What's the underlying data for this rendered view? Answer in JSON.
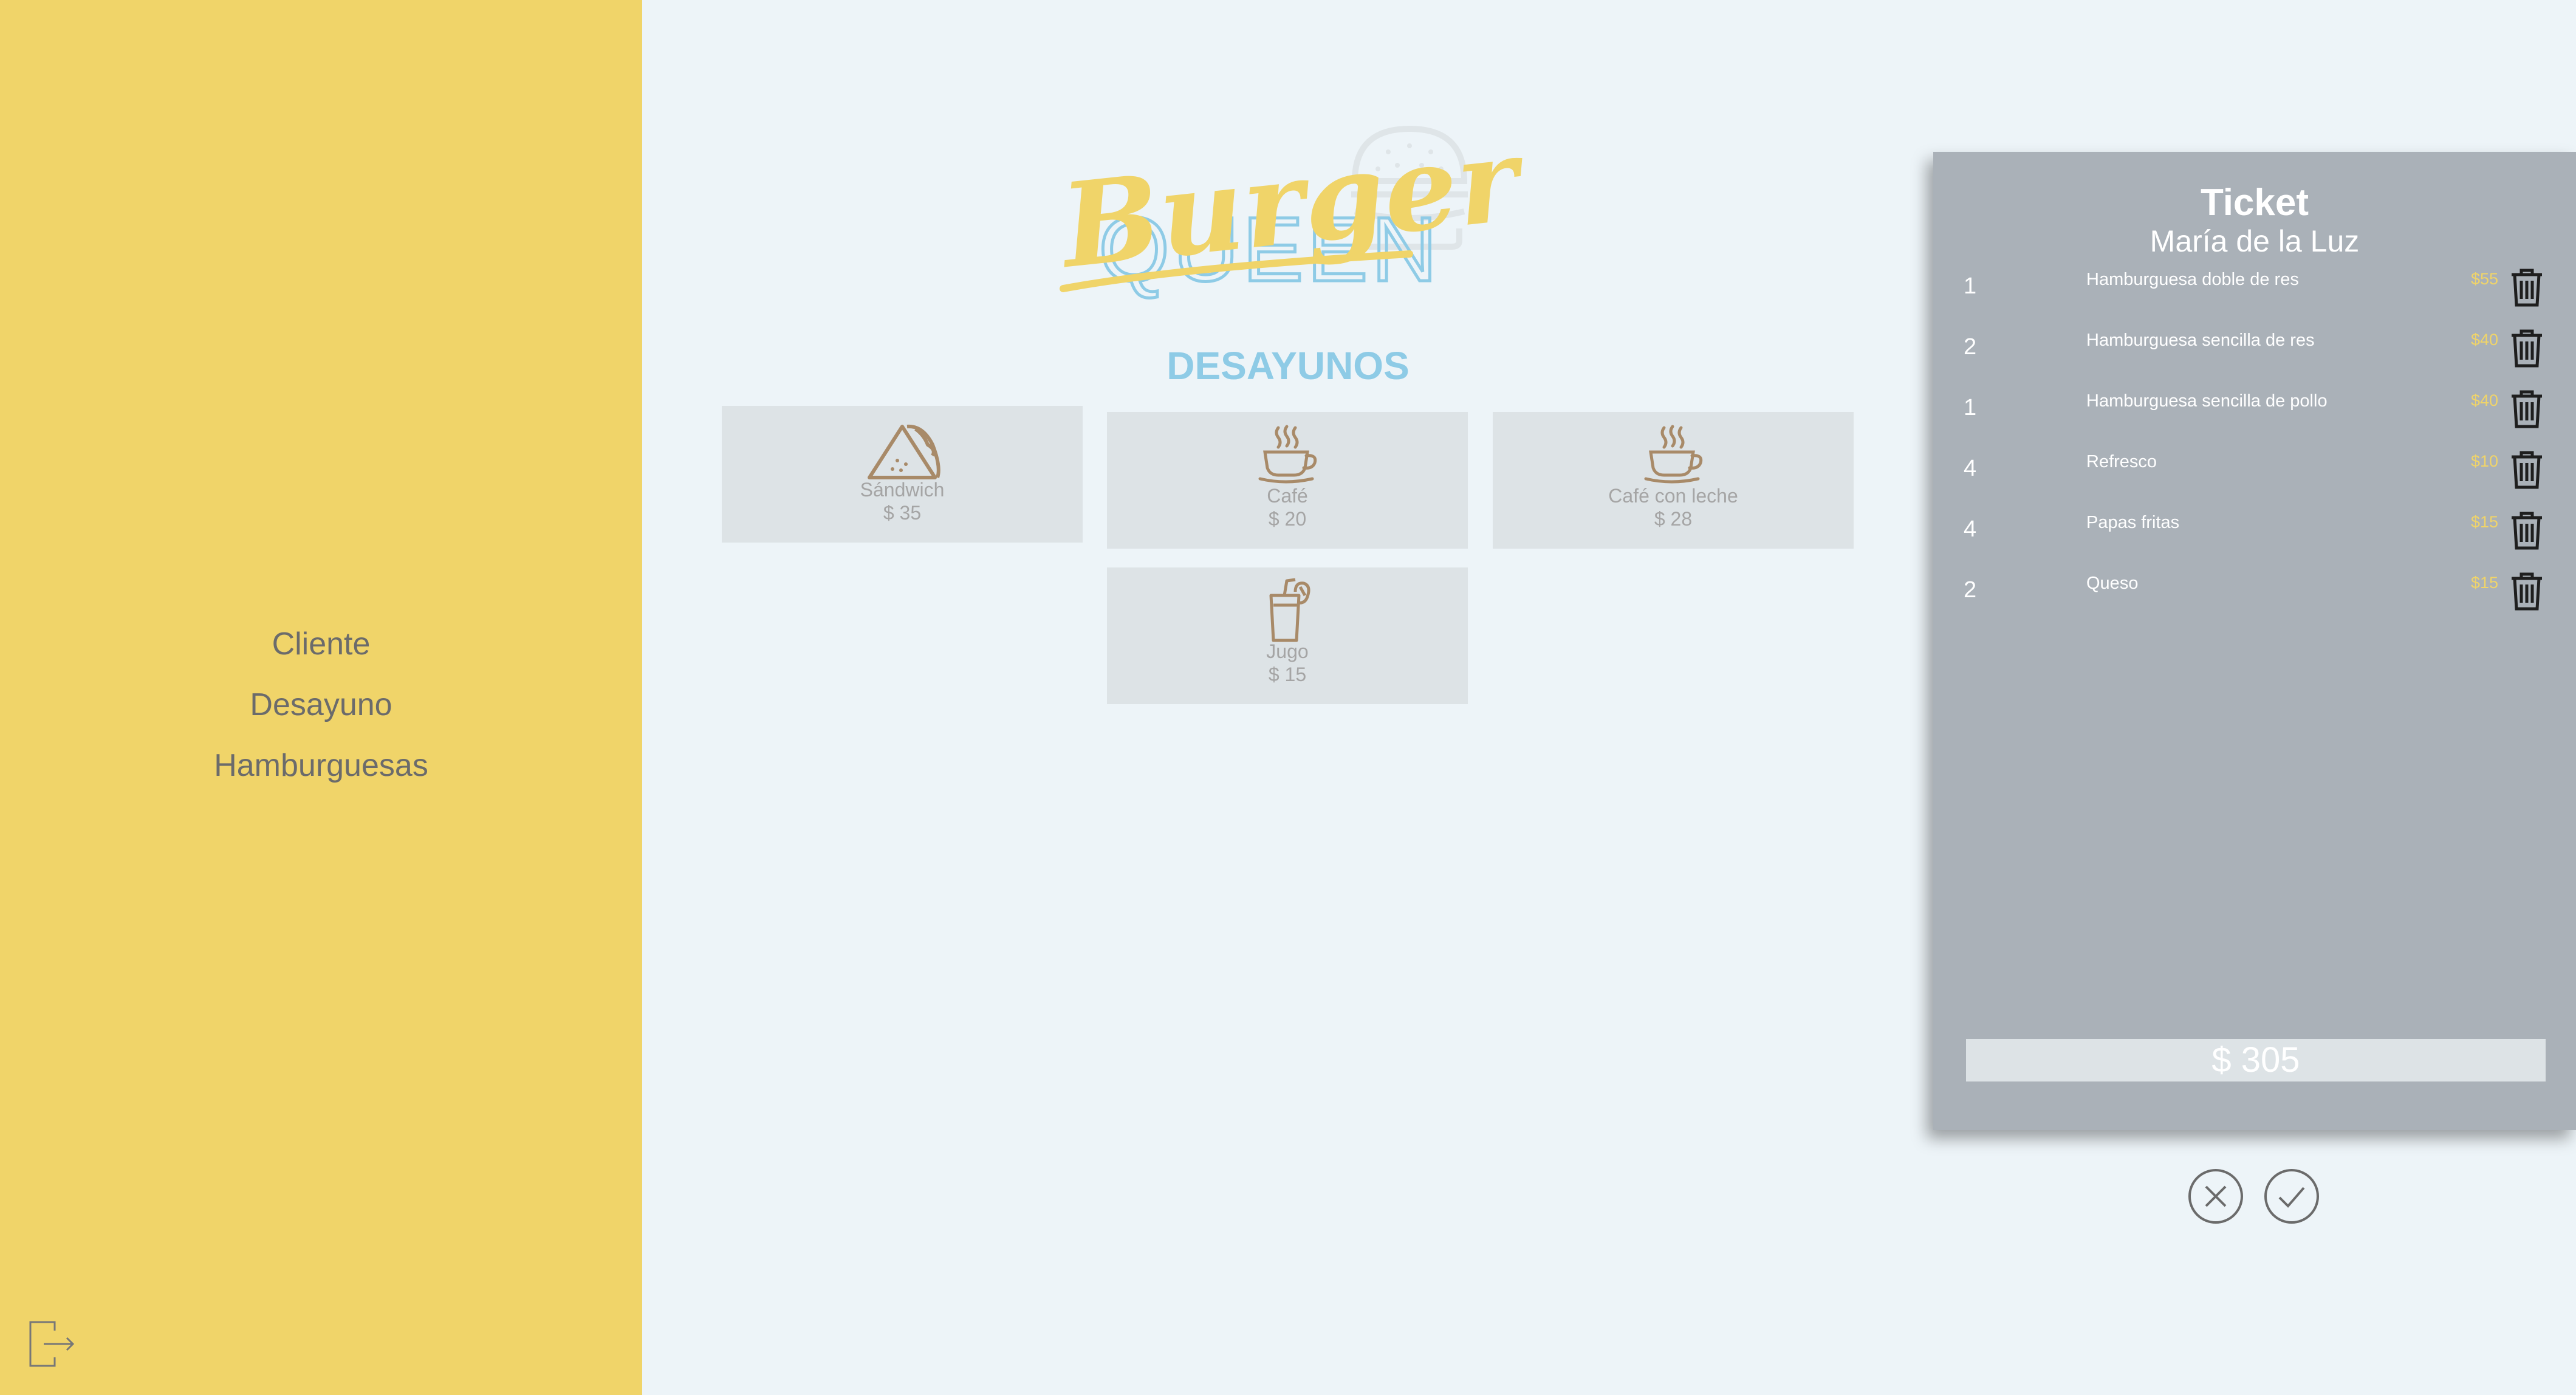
{
  "brand": {
    "logo_line1": "Burger",
    "logo_line2": "QUEEN"
  },
  "sidebar": {
    "items": [
      {
        "label": "Cliente"
      },
      {
        "label": "Desayuno"
      },
      {
        "label": "Hamburguesas"
      }
    ],
    "logout_icon": "logout-icon"
  },
  "menu": {
    "title": "DESAYUNOS",
    "products": [
      {
        "name": "Sándwich",
        "price": "$ 35",
        "icon": "sandwich-icon"
      },
      {
        "name": "Café",
        "price": "$ 20",
        "icon": "coffee-cup-icon"
      },
      {
        "name": "Café con leche",
        "price": "$ 28",
        "icon": "coffee-cup-icon"
      },
      {
        "name": "Jugo",
        "price": "$ 15",
        "icon": "juice-glass-icon"
      }
    ]
  },
  "ticket": {
    "title": "Ticket",
    "client": "María de la Luz",
    "items": [
      {
        "qty": "1",
        "name": "Hamburguesa doble de res",
        "price": "$55"
      },
      {
        "qty": "2",
        "name": "Hamburguesa sencilla de res",
        "price": "$40"
      },
      {
        "qty": "1",
        "name": "Hamburguesa sencilla de pollo",
        "price": "$40"
      },
      {
        "qty": "4",
        "name": "Refresco",
        "price": "$10"
      },
      {
        "qty": "4",
        "name": "Papas fritas",
        "price": "$15"
      },
      {
        "qty": "2",
        "name": "Queso",
        "price": "$15"
      }
    ],
    "total": "$ 305",
    "cancel_icon": "close-circle-icon",
    "confirm_icon": "check-circle-icon"
  },
  "colors": {
    "sidebar": "#f0d469",
    "background": "#edf4f8",
    "ticket": "#aab1b8",
    "accent_blue": "#8ecbe6",
    "icon_brown": "#a88a68"
  }
}
